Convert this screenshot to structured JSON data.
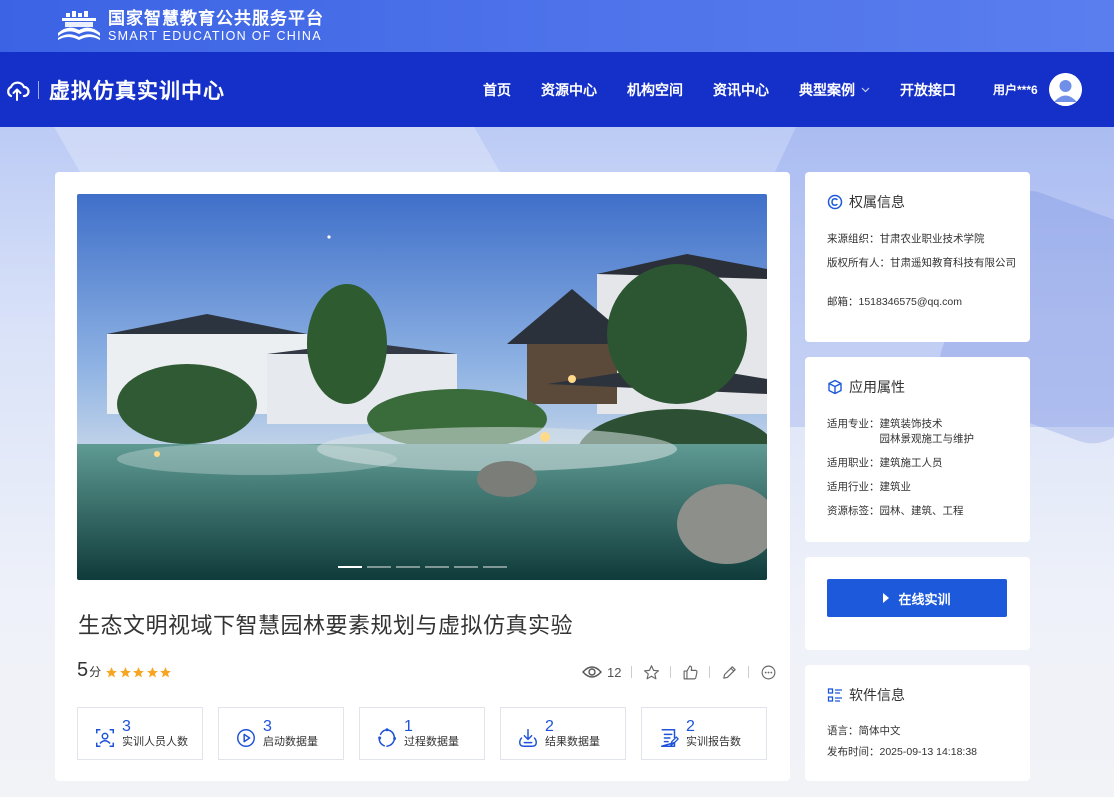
{
  "topbar": {
    "brand_cn": "国家智慧教育公共服务平台",
    "brand_en": "SMART EDUCATION OF CHINA"
  },
  "navbar": {
    "site_title": "虚拟仿真实训中心",
    "menu": [
      "首页",
      "资源中心",
      "机构空间",
      "资讯中心",
      "典型案例",
      "开放接口"
    ],
    "user_name": "用户***6"
  },
  "colors": {
    "nav_blue": "#1530c9",
    "top_blue": "#3b63e4",
    "accent_blue": "#1d59db",
    "star_orange": "#f7a623"
  },
  "course": {
    "title": "生态文明视域下智慧园林要素规划与虚拟仿真实验",
    "score": "5",
    "score_unit": "分",
    "rating": 5,
    "views": "12",
    "slide_count": 6,
    "active_slide": 1
  },
  "stats": [
    {
      "value": "3",
      "label": "实训人员人数",
      "icon": "users-icon"
    },
    {
      "value": "3",
      "label": "启动数据量",
      "icon": "play-icon"
    },
    {
      "value": "1",
      "label": "过程数据量",
      "icon": "cycle-icon"
    },
    {
      "value": "2",
      "label": "结果数据量",
      "icon": "download-check-icon"
    },
    {
      "value": "2",
      "label": "实训报告数",
      "icon": "report-icon"
    }
  ],
  "ownership": {
    "title": "权属信息",
    "source_label": "来源组织：",
    "source_value": "甘肃农业职业技术学院",
    "owner_label": "版权所有人：",
    "owner_value": "甘肃遥知教育科技有限公司",
    "email_label": "邮箱：",
    "email_value": "1518346575@qq.com"
  },
  "attributes": {
    "title": "应用属性",
    "major_label": "适用专业：",
    "major_value_1": "建筑装饰技术",
    "major_value_2": "园林景观施工与维护",
    "job_label": "适用职业：",
    "job_value": "建筑施工人员",
    "industry_label": "适用行业：",
    "industry_value": "建筑业",
    "tags_label": "资源标签：",
    "tags_value": "园林、建筑、工程"
  },
  "train": {
    "button_label": "在线实训"
  },
  "software": {
    "title": "软件信息",
    "lang_label": "语言：",
    "lang_value": "简体中文",
    "date_label": "发布时间：",
    "date_value": "2025-09-13 14:18:38"
  }
}
